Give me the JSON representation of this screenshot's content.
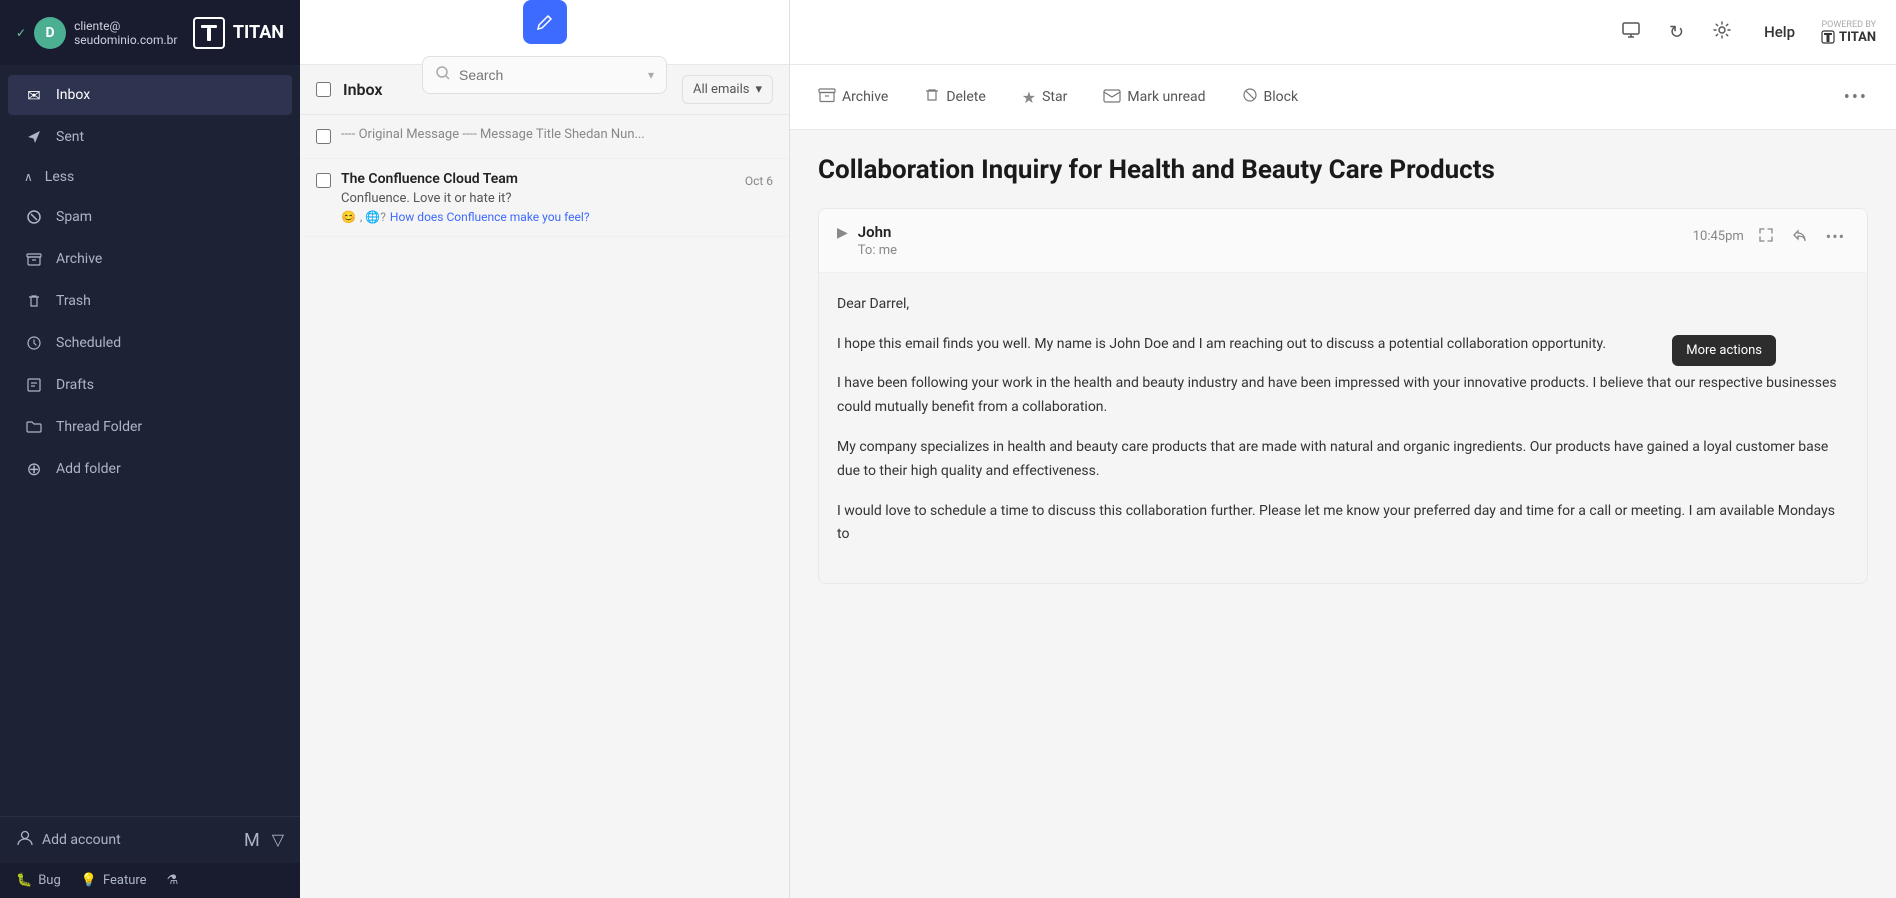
{
  "sidebar": {
    "account": {
      "checkmark": "✓",
      "avatar_letter": "D",
      "email": "cliente@ seudominio.com.br"
    },
    "logo": {
      "name": "TITAN",
      "icon": "⊓"
    },
    "nav_items": [
      {
        "id": "inbox",
        "label": "Inbox",
        "icon": "✉",
        "active": true
      },
      {
        "id": "sent",
        "label": "Sent",
        "icon": "➤",
        "active": false
      }
    ],
    "less_label": "Less",
    "secondary_nav": [
      {
        "id": "spam",
        "label": "Spam",
        "icon": "⊘"
      },
      {
        "id": "archive",
        "label": "Archive",
        "icon": "🗃"
      },
      {
        "id": "trash",
        "label": "Trash",
        "icon": "🗑"
      },
      {
        "id": "scheduled",
        "label": "Scheduled",
        "icon": "⏰"
      },
      {
        "id": "drafts",
        "label": "Drafts",
        "icon": "📋"
      },
      {
        "id": "thread_folder",
        "label": "Thread Folder",
        "icon": "📁"
      }
    ],
    "add_folder_label": "Add folder",
    "add_account_label": "Add account",
    "footer_icons": [
      "M",
      "▽"
    ],
    "bottom_bar": [
      {
        "id": "bug",
        "label": "Bug",
        "icon": "🐛"
      },
      {
        "id": "feature",
        "label": "Feature",
        "icon": "💡"
      },
      {
        "id": "labs",
        "icon": "⚗"
      }
    ]
  },
  "email_list": {
    "compose_icon": "✏",
    "search_placeholder": "Search",
    "search_dropdown_icon": "▾",
    "title": "Inbox",
    "filter_label": "All emails",
    "filter_icon": "▾",
    "items": [
      {
        "id": 1,
        "sender": "---- Original Message ---- Message Title Shedan Nun...",
        "subject": "",
        "preview": "",
        "date": "",
        "checked": false
      },
      {
        "id": 2,
        "sender": "The Confluence Cloud Team",
        "subject": "Confluence. Love it or hate it?",
        "preview": "😊, 🌐? How does Confluence make you feel?",
        "date": "Oct 6",
        "checked": false
      }
    ]
  },
  "email_detail": {
    "toolbar": {
      "archive_label": "Archive",
      "archive_icon": "🗃",
      "delete_label": "Delete",
      "delete_icon": "🗑",
      "star_label": "Star",
      "star_icon": "★",
      "mark_unread_label": "Mark unread",
      "mark_unread_icon": "✉",
      "block_label": "Block",
      "block_icon": "⊘",
      "more_icon": "•••"
    },
    "subject": "Collaboration Inquiry for Health and Beauty Care Products",
    "email_card": {
      "sender_name": "John",
      "to": "To: me",
      "time": "10:45pm",
      "expand_icon": "▶",
      "fullscreen_icon": "⤢",
      "reply_icon": "↩",
      "more_icon": "•••"
    },
    "body_paragraphs": [
      "Dear Darrel,",
      "I hope this email finds you well. My name is John Doe and I am reaching out to discuss a potential collaboration opportunity.",
      "I have been following your work in the health and beauty industry and have been impressed with your innovative products. I believe that our respective businesses could mutually benefit from a collaboration.",
      "My company specializes in health and beauty care products that are made with natural and organic ingredients. Our products have gained a loyal customer base due to their high quality and effectiveness.",
      "I would love to schedule a time to discuss this collaboration further. Please let me know your preferred day and time for a call or meeting. I am available Mondays to"
    ],
    "more_actions_tooltip": "More actions"
  },
  "top_header": {
    "monitor_icon": "👁",
    "refresh_icon": "↻",
    "settings_icon": "⚙",
    "help_label": "Help",
    "powered_by_label": "POWERED BY",
    "powered_by_brand": "✦ TITAN"
  }
}
